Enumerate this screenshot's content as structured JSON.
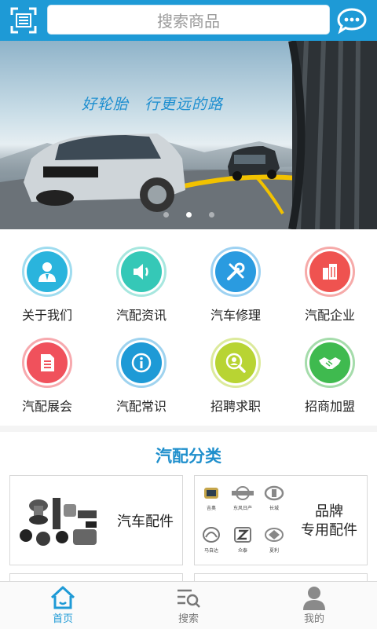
{
  "header": {
    "search_placeholder": "搜索商品",
    "scan_icon": "qr-scan-icon",
    "message_icon": "chat-bubble-icon"
  },
  "banner": {
    "slogan": "好轮胎　行更远的路",
    "dots_count": 3,
    "active_dot": 1
  },
  "menu": [
    {
      "label": "关于我们",
      "icon": "person-icon",
      "color": "#2ab4dd"
    },
    {
      "label": "汽配资讯",
      "icon": "speaker-icon",
      "color": "#35c8b7"
    },
    {
      "label": "汽车修理",
      "icon": "wrench-icon",
      "color": "#2a9be0"
    },
    {
      "label": "汽配企业",
      "icon": "building-icon",
      "color": "#ef5350"
    },
    {
      "label": "汽配展会",
      "icon": "document-icon",
      "color": "#f0515c"
    },
    {
      "label": "汽配常识",
      "icon": "info-icon",
      "color": "#1e9ad6"
    },
    {
      "label": "招聘求职",
      "icon": "job-search-icon",
      "color": "#b8d433"
    },
    {
      "label": "招商加盟",
      "icon": "handshake-icon",
      "color": "#3fba4f"
    }
  ],
  "category": {
    "title": "汽配分类",
    "cards": [
      {
        "label": "汽车配件"
      },
      {
        "label_line1": "品牌",
        "label_line2": "专用配件"
      }
    ],
    "brand_logos": [
      "吉奥",
      "东风日产",
      "长城",
      "马自达",
      "众泰",
      "夏利"
    ]
  },
  "tabbar": {
    "items": [
      {
        "label": "首页",
        "icon": "home-icon",
        "active": true
      },
      {
        "label": "搜索",
        "icon": "search-list-icon",
        "active": false
      },
      {
        "label": "我的",
        "icon": "user-icon",
        "active": false
      }
    ]
  },
  "colors": {
    "brand": "#1e9ad6",
    "title_blue": "#1f8fcc"
  }
}
